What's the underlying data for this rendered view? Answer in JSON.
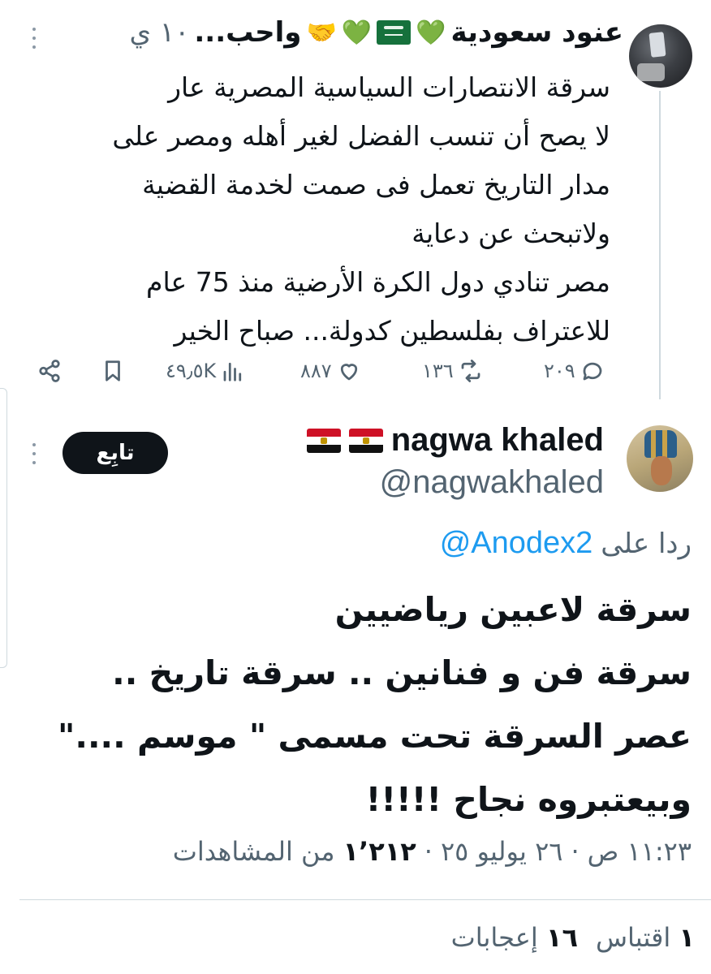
{
  "parent_tweet": {
    "author_name": "عنود سعودية",
    "name_suffix": "واحب...",
    "time": "١٠ ي",
    "name_emojis": [
      "💚",
      "💚",
      "🤝"
    ],
    "body_lines": [
      "سرقة الانتصارات السياسية  المصرية عار",
      " لا يصح أن تنسب الفضل لغير أهله ومصر على",
      "مدار التاريخ تعمل فى صمت لخدمة القضية",
      "ولاتبحث عن دعاية",
      "مصر تنادي دول الكرة الأرضية منذ 75 عام",
      "للاعتراف بفلسطين كدولة... صباح الخير"
    ],
    "replies": "٢٠٩",
    "reposts": "١٣٦",
    "likes": "٨٨٧",
    "views": "٤٩٫٥K"
  },
  "main_tweet": {
    "author_name": "nagwa khaled",
    "handle": "@nagwakhaled",
    "follow_label": "تابِع",
    "reply_label": "ردا على",
    "reply_to": "@Anodex2",
    "body_lines": [
      "سرقة لاعبين رياضيين",
      "سرقة فن و فنانين .. سرقة تاريخ ..",
      "عصر السرقة تحت مسمى \" موسم ....\"",
      "وبيعتبروه نجاح !!!!!"
    ],
    "time": "١١:٢٣ ص",
    "date": "٢٦ يوليو ٢٥",
    "separator": "·",
    "views_count": "١٬٢١٢",
    "views_label": "من المشاهدات",
    "quotes_count": "١",
    "quotes_label": "اقتباس",
    "likes_count": "١٦",
    "likes_label": "إعجابات"
  },
  "colors": {
    "text": "#0f1419",
    "secondary": "#536471",
    "link": "#1d9bf0",
    "divider": "#cfd9de"
  }
}
